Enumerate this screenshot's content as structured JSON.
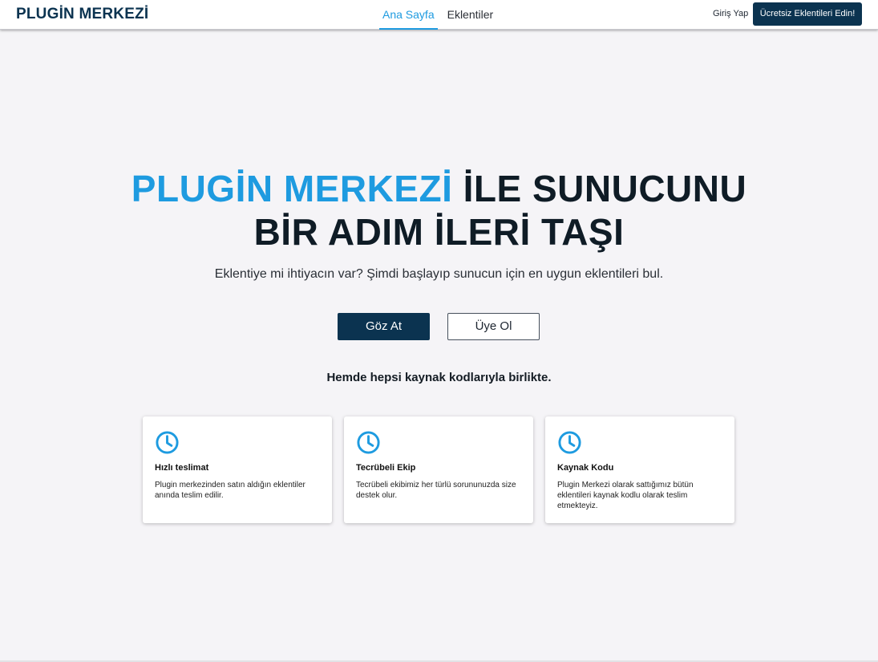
{
  "header": {
    "logo": "PLUGİN MERKEZİ",
    "nav": [
      {
        "label": "Ana Sayfa",
        "active": true
      },
      {
        "label": "Eklentiler",
        "active": false
      }
    ],
    "login_label": "Giriş Yap",
    "cta_label": "Ücretsiz Eklentileri Edin!"
  },
  "hero": {
    "title_brand": "PLUGİN MERKEZİ",
    "title_rest_1": "İLE SUNUCUNU",
    "title_line2": "BİR ADIM İLERİ TAŞI",
    "subtitle": "Eklentiye mi ihtiyacın var? Şimdi başlayıp sunucun için en uygun eklentileri bul.",
    "primary_button": "Göz At",
    "secondary_button": "Üye Ol",
    "tagline": "Hemde hepsi kaynak kodlarıyla birlikte."
  },
  "features": [
    {
      "icon": "clock-icon",
      "title": "Hızlı teslimat",
      "text": "Plugin merkezinden satın aldığın eklentiler anında teslim edilir."
    },
    {
      "icon": "clock-icon",
      "title": "Tecrübeli Ekip",
      "text": "Tecrübeli ekibimiz her türlü sorununuzda size destek olur."
    },
    {
      "icon": "clock-icon",
      "title": "Kaynak Kodu",
      "text": "Plugin Merkezi olarak sattığımız bütün eklentileri kaynak kodlu olarak teslim etmekteyiz."
    }
  ],
  "colors": {
    "brand_blue": "#1e9be0",
    "navy": "#0b3350",
    "background": "#f5f4f7"
  }
}
